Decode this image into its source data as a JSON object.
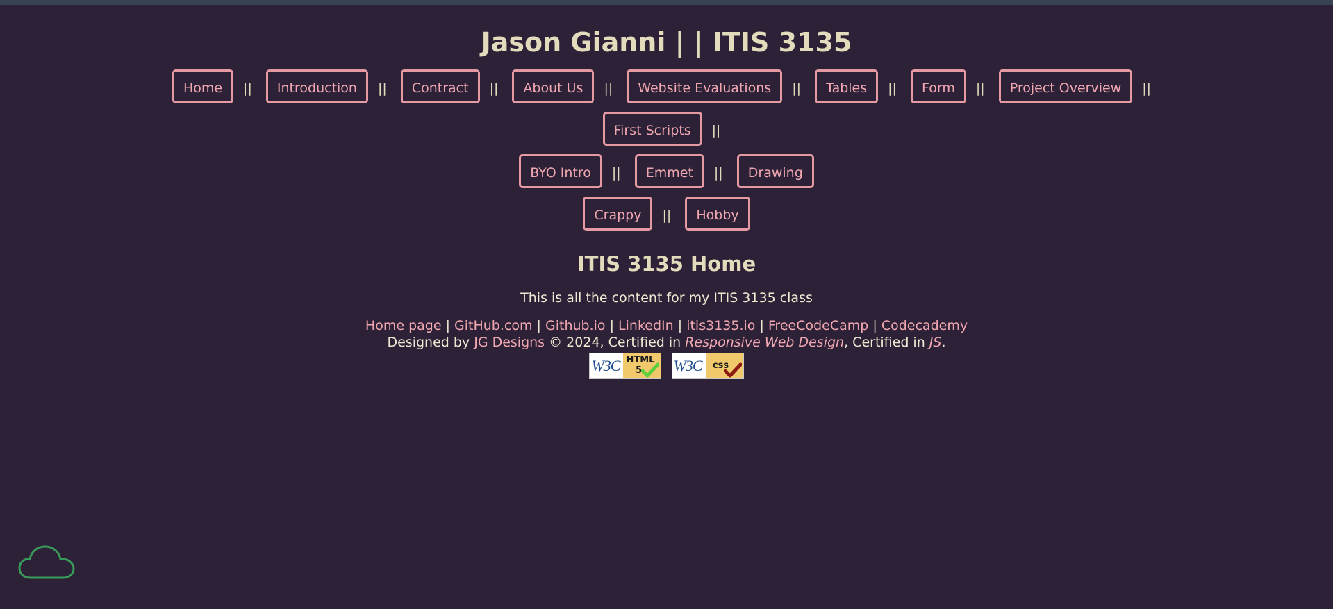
{
  "header": {
    "title": "Jason Gianni | | ITIS 3135"
  },
  "nav": {
    "separator": "||",
    "items": [
      {
        "label": "Home"
      },
      {
        "label": "Introduction"
      },
      {
        "label": "Contract"
      },
      {
        "label": "About Us"
      },
      {
        "label": "Website Evaluations"
      },
      {
        "label": "Tables"
      },
      {
        "label": "Form"
      },
      {
        "label": "Project Overview"
      },
      {
        "label": "First Scripts"
      },
      {
        "label": "BYO Intro"
      },
      {
        "label": "Emmet"
      },
      {
        "label": "Drawing"
      },
      {
        "label": "Crappy"
      },
      {
        "label": "Hobby"
      }
    ]
  },
  "main": {
    "heading": "ITIS 3135 Home",
    "intro": "This is all the content for my ITIS 3135 class"
  },
  "footer": {
    "links": [
      {
        "label": "Home page"
      },
      {
        "label": "GitHub.com"
      },
      {
        "label": "Github.io"
      },
      {
        "label": "LinkedIn"
      },
      {
        "label": "itis3135.io"
      },
      {
        "label": "FreeCodeCamp"
      },
      {
        "label": "Codecademy"
      }
    ],
    "link_separator": "|",
    "designed_by_prefix": "Designed by ",
    "designer_link": "JG Designs",
    "copyright": " © 2024, Certified in ",
    "cert1": "Responsive Web Design",
    "mid": ", Certified in ",
    "cert2": "JS",
    "end": ".",
    "badges": {
      "html": {
        "w3c": "W3C",
        "line1": "HTML",
        "line2": "5"
      },
      "css": {
        "w3c": "W3C",
        "line1": "css"
      }
    }
  },
  "colors": {
    "background": "#2d2137",
    "accent": "#f0a7b0",
    "text": "#e3dcbc",
    "cloud": "#3a9a5a"
  },
  "icons": {
    "cloud": "cloud-icon"
  }
}
